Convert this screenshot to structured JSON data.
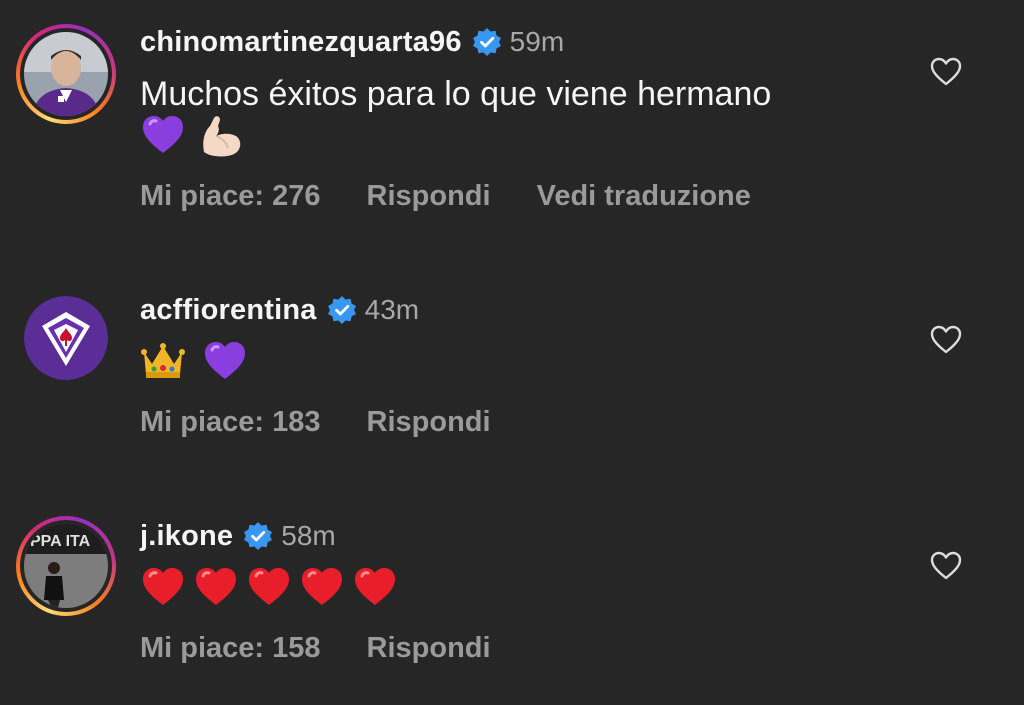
{
  "comments": [
    {
      "username": "chinomartinezquarta96",
      "time": "59m",
      "text": "Muchos éxitos para lo que viene hermano",
      "emojis": [
        "purple-heart",
        "flexed-biceps"
      ],
      "likes": "Mi piace: 276",
      "reply": "Rispondi",
      "translate": "Vedi traduzione",
      "has_story_ring": true
    },
    {
      "username": "acffiorentina",
      "time": "43m",
      "emojis": [
        "crown",
        "purple-heart"
      ],
      "likes": "Mi piace: 183",
      "reply": "Rispondi",
      "has_story_ring": false
    },
    {
      "username": "j.ikone",
      "time": "58m",
      "emojis": [
        "red-heart",
        "red-heart",
        "red-heart",
        "red-heart",
        "red-heart"
      ],
      "likes": "Mi piace: 158",
      "reply": "Rispondi",
      "has_story_ring": true
    }
  ],
  "colors": {
    "background": "#262626",
    "text": "#f5f5f5",
    "muted": "#a8a8a8",
    "verified": "#3897f0",
    "purple": "#7b2fbe"
  }
}
